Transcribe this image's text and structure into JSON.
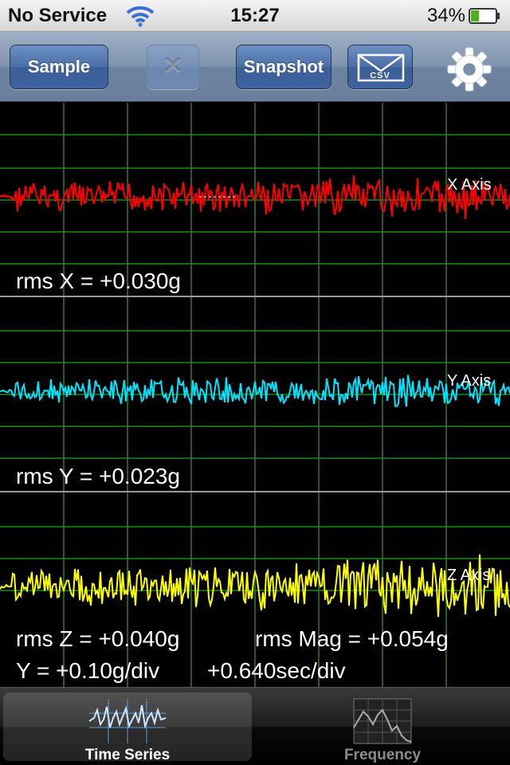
{
  "status_bar": {
    "carrier": "No Service",
    "time": "15:27",
    "battery_percent": "34%",
    "battery_level": 0.34
  },
  "toolbar": {
    "sample_label": "Sample",
    "clear_symbol": "✕",
    "snapshot_label": "Snapshot",
    "email_csv_label": "CSV",
    "settings_icon": "gear-icon"
  },
  "plot": {
    "x_axis_label": "X Axis",
    "y_axis_label": "Y Axis",
    "z_axis_label": "Z Axis",
    "rms_x": "rms X = +0.030g",
    "rms_y": "rms Y = +0.023g",
    "rms_z": "rms Z = +0.040g",
    "rms_mag": "rms Mag = +0.054g",
    "y_scale": "Y = +0.10g/div",
    "time_scale": "+0.640sec/div",
    "colors": {
      "grid": "#1e8a1e",
      "x_trace": "#ff0000",
      "y_trace": "#00e5ff",
      "z_trace": "#ffff00"
    }
  },
  "tabs": [
    {
      "label": "Time Series",
      "active": true
    },
    {
      "label": "Frequency",
      "active": false
    }
  ]
}
